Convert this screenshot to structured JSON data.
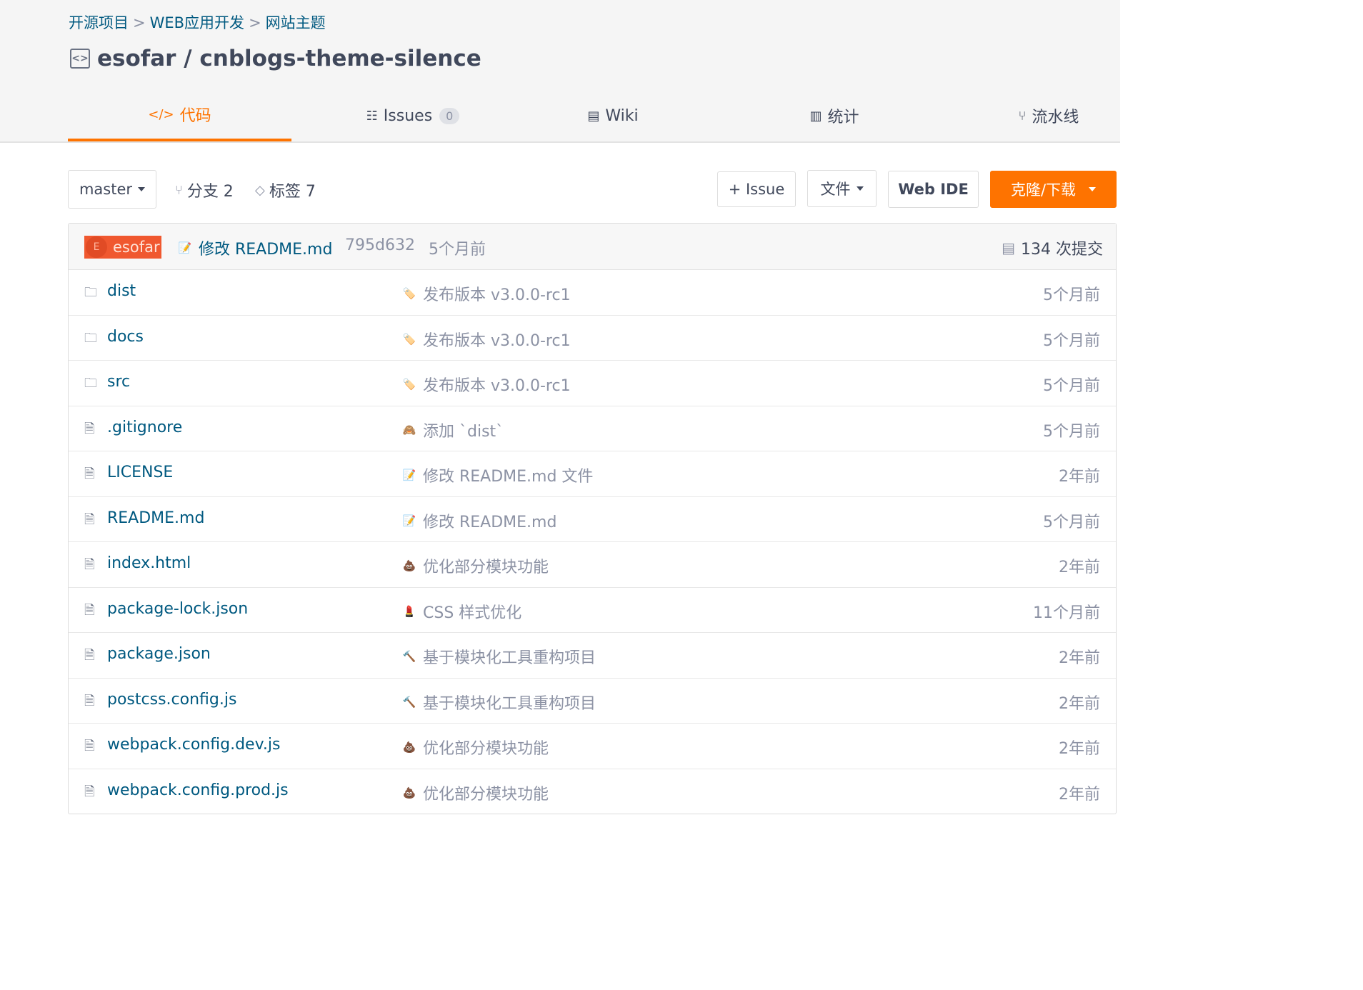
{
  "breadcrumb": {
    "items": [
      "开源项目",
      "WEB应用开发",
      "网站主题"
    ],
    "sep": ">"
  },
  "repo": {
    "title": "esofar / cnblogs-theme-silence"
  },
  "tabs": [
    {
      "label": "代码",
      "icon": "</>"
    },
    {
      "label": "Issues",
      "icon": "issues-icon",
      "count": "0"
    },
    {
      "label": "Wiki",
      "icon": "wiki-icon"
    },
    {
      "label": "统计",
      "icon": "chart-icon"
    },
    {
      "label": "流水线",
      "icon": "pipeline-icon"
    }
  ],
  "toolbar": {
    "branch": "master",
    "branches": "分支 2",
    "tags": "标签 7",
    "issue_btn": "+ Issue",
    "file_btn": "文件",
    "webide_btn": "Web IDE",
    "clone_btn": "克隆/下载"
  },
  "last_commit": {
    "avatar_letter": "E",
    "author": "esofar",
    "message": "修改 README.md",
    "hash": "795d632",
    "time": "5个月前",
    "commits": "134 次提交"
  },
  "files": [
    {
      "type": "folder",
      "name": "dist",
      "emoji": "🏷️",
      "msg": "发布版本 v3.0.0-rc1",
      "time": "5个月前"
    },
    {
      "type": "folder",
      "name": "docs",
      "emoji": "🏷️",
      "msg": "发布版本 v3.0.0-rc1",
      "time": "5个月前"
    },
    {
      "type": "folder",
      "name": "src",
      "emoji": "🏷️",
      "msg": "发布版本 v3.0.0-rc1",
      "time": "5个月前"
    },
    {
      "type": "file",
      "name": ".gitignore",
      "emoji": "🙈",
      "msg": "添加 `dist`",
      "time": "5个月前"
    },
    {
      "type": "file",
      "name": "LICENSE",
      "emoji": "📝",
      "msg": "修改 README.md 文件",
      "time": "2年前"
    },
    {
      "type": "file",
      "name": "README.md",
      "emoji": "📝",
      "msg": "修改 README.md",
      "time": "5个月前"
    },
    {
      "type": "file",
      "name": "index.html",
      "emoji": "💩",
      "msg": "优化部分模块功能",
      "time": "2年前"
    },
    {
      "type": "file",
      "name": "package-lock.json",
      "emoji": "💄",
      "msg": "CSS 样式优化",
      "time": "11个月前"
    },
    {
      "type": "file",
      "name": "package.json",
      "emoji": "🔨",
      "msg": "基于模块化工具重构项目",
      "time": "2年前"
    },
    {
      "type": "file",
      "name": "postcss.config.js",
      "emoji": "🔨",
      "msg": "基于模块化工具重构项目",
      "time": "2年前"
    },
    {
      "type": "file",
      "name": "webpack.config.dev.js",
      "emoji": "💩",
      "msg": "优化部分模块功能",
      "time": "2年前"
    },
    {
      "type": "file",
      "name": "webpack.config.prod.js",
      "emoji": "💩",
      "msg": "优化部分模块功能",
      "time": "2年前"
    }
  ]
}
